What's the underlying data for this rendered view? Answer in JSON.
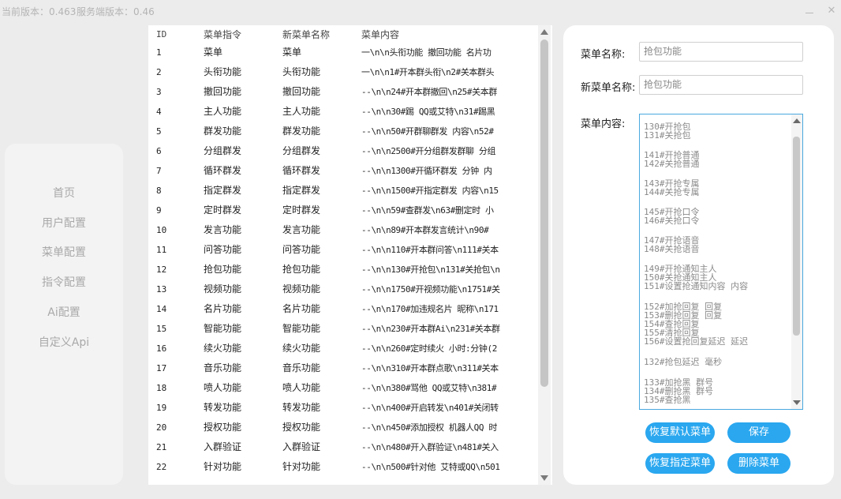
{
  "app": {
    "client_version": "当前版本：0.463",
    "server_version": "服务端版本：0.46"
  },
  "window": {
    "close_icon": "✕"
  },
  "sidebar": {
    "items": [
      {
        "label": "首页"
      },
      {
        "label": "用户配置"
      },
      {
        "label": "菜单配置"
      },
      {
        "label": "指令配置"
      },
      {
        "label": "Ai配置"
      },
      {
        "label": "自定义Api"
      }
    ]
  },
  "table": {
    "headers": {
      "id": "ID",
      "cmd": "菜单指令",
      "new": "新菜单名称",
      "content": "菜单内容"
    },
    "rows": [
      {
        "id": "1",
        "cmd": "菜单",
        "new": "菜单",
        "content": "一\\n\\n头衔功能 撤回功能 名片功"
      },
      {
        "id": "2",
        "cmd": "头衔功能",
        "new": "头衔功能",
        "content": "一\\n\\n1#开本群头衔\\n2#关本群头"
      },
      {
        "id": "3",
        "cmd": "撤回功能",
        "new": "撤回功能",
        "content": "--\\n\\n24#开本群撤回\\n25#关本群"
      },
      {
        "id": "4",
        "cmd": "主人功能",
        "new": "主人功能",
        "content": "--\\n\\n30#踢 QQ或艾特\\n31#踢黑"
      },
      {
        "id": "5",
        "cmd": "群发功能",
        "new": "群发功能",
        "content": "--\\n\\n50#开群聊群发 内容\\n52#"
      },
      {
        "id": "6",
        "cmd": "分组群发",
        "new": "分组群发",
        "content": "--\\n\\n2500#开分组群发群聊 分组"
      },
      {
        "id": "7",
        "cmd": "循环群发",
        "new": "循环群发",
        "content": "--\\n\\n1300#开循环群发 分钟 内"
      },
      {
        "id": "8",
        "cmd": "指定群发",
        "new": "指定群发",
        "content": "--\\n\\n1500#开指定群发 内容\\n15"
      },
      {
        "id": "9",
        "cmd": "定时群发",
        "new": "定时群发",
        "content": "--\\n\\n59#查群发\\n63#删定时 小"
      },
      {
        "id": "10",
        "cmd": "发言功能",
        "new": "发言功能",
        "content": "--\\n\\n89#开本群发言统计\\n90#"
      },
      {
        "id": "11",
        "cmd": "问答功能",
        "new": "问答功能",
        "content": "--\\n\\n110#开本群问答\\n111#关本"
      },
      {
        "id": "12",
        "cmd": "抢包功能",
        "new": "抢包功能",
        "content": "--\\n\\n130#开抢包\\n131#关抢包\\n"
      },
      {
        "id": "13",
        "cmd": "视频功能",
        "new": "视频功能",
        "content": "--\\n\\n1750#开视频功能\\n1751#关"
      },
      {
        "id": "14",
        "cmd": "名片功能",
        "new": "名片功能",
        "content": "--\\n\\n170#加违规名片 昵称\\n171"
      },
      {
        "id": "15",
        "cmd": "智能功能",
        "new": "智能功能",
        "content": "--\\n\\n230#开本群Ai\\n231#关本群"
      },
      {
        "id": "16",
        "cmd": "续火功能",
        "new": "续火功能",
        "content": "--\\n\\n260#定时续火 小时:分钟(2"
      },
      {
        "id": "17",
        "cmd": "音乐功能",
        "new": "音乐功能",
        "content": "--\\n\\n310#开本群点歌\\n311#关本"
      },
      {
        "id": "18",
        "cmd": "喷人功能",
        "new": "喷人功能",
        "content": "--\\n\\n380#骂他 QQ或艾特\\n381#"
      },
      {
        "id": "19",
        "cmd": "转发功能",
        "new": "转发功能",
        "content": "--\\n\\n400#开启转发\\n401#关闭转"
      },
      {
        "id": "20",
        "cmd": "授权功能",
        "new": "授权功能",
        "content": "--\\n\\n450#添加授权 机器人QQ 时"
      },
      {
        "id": "21",
        "cmd": "入群验证",
        "new": "入群验证",
        "content": "--\\n\\n480#开入群验证\\n481#关入"
      },
      {
        "id": "22",
        "cmd": "针对功能",
        "new": "针对功能",
        "content": "--\\n\\n500#针对他 艾特或QQ\\n501"
      }
    ]
  },
  "form": {
    "menu_name_label": "菜单名称:",
    "menu_name_value": "抢包功能",
    "new_menu_name_label": "新菜单名称:",
    "new_menu_name_value": "抢包功能",
    "content_label": "菜单内容:",
    "content_lines": [
      "130#开抢包",
      "131#关抢包",
      "141#开抢普通",
      "142#关抢普通",
      "143#开抢专属",
      "144#关抢专属",
      "145#开抢口令",
      "146#关抢口令",
      "147#开抢语音",
      "148#关抢语音",
      "149#开抢通知主人",
      "150#关抢通知主人",
      "151#设置抢通知内容 内容",
      "152#加抢回复 回复",
      "153#删抢回复 回复",
      "154#查抢回复",
      "155#清抢回复",
      "156#设置抢回复延迟 延迟",
      "132#抢包延迟 毫秒",
      "133#加抢黑 群号",
      "134#删抢黑 群号",
      "135#查抢黑"
    ]
  },
  "buttons": {
    "restore_default": "恢复默认菜单",
    "save": "保存",
    "restore_specified": "恢复指定菜单",
    "delete": "删除菜单"
  },
  "colors": {
    "accent": "#2aa7ef",
    "focus_border": "#4aa8e0",
    "background": "#ececec"
  }
}
